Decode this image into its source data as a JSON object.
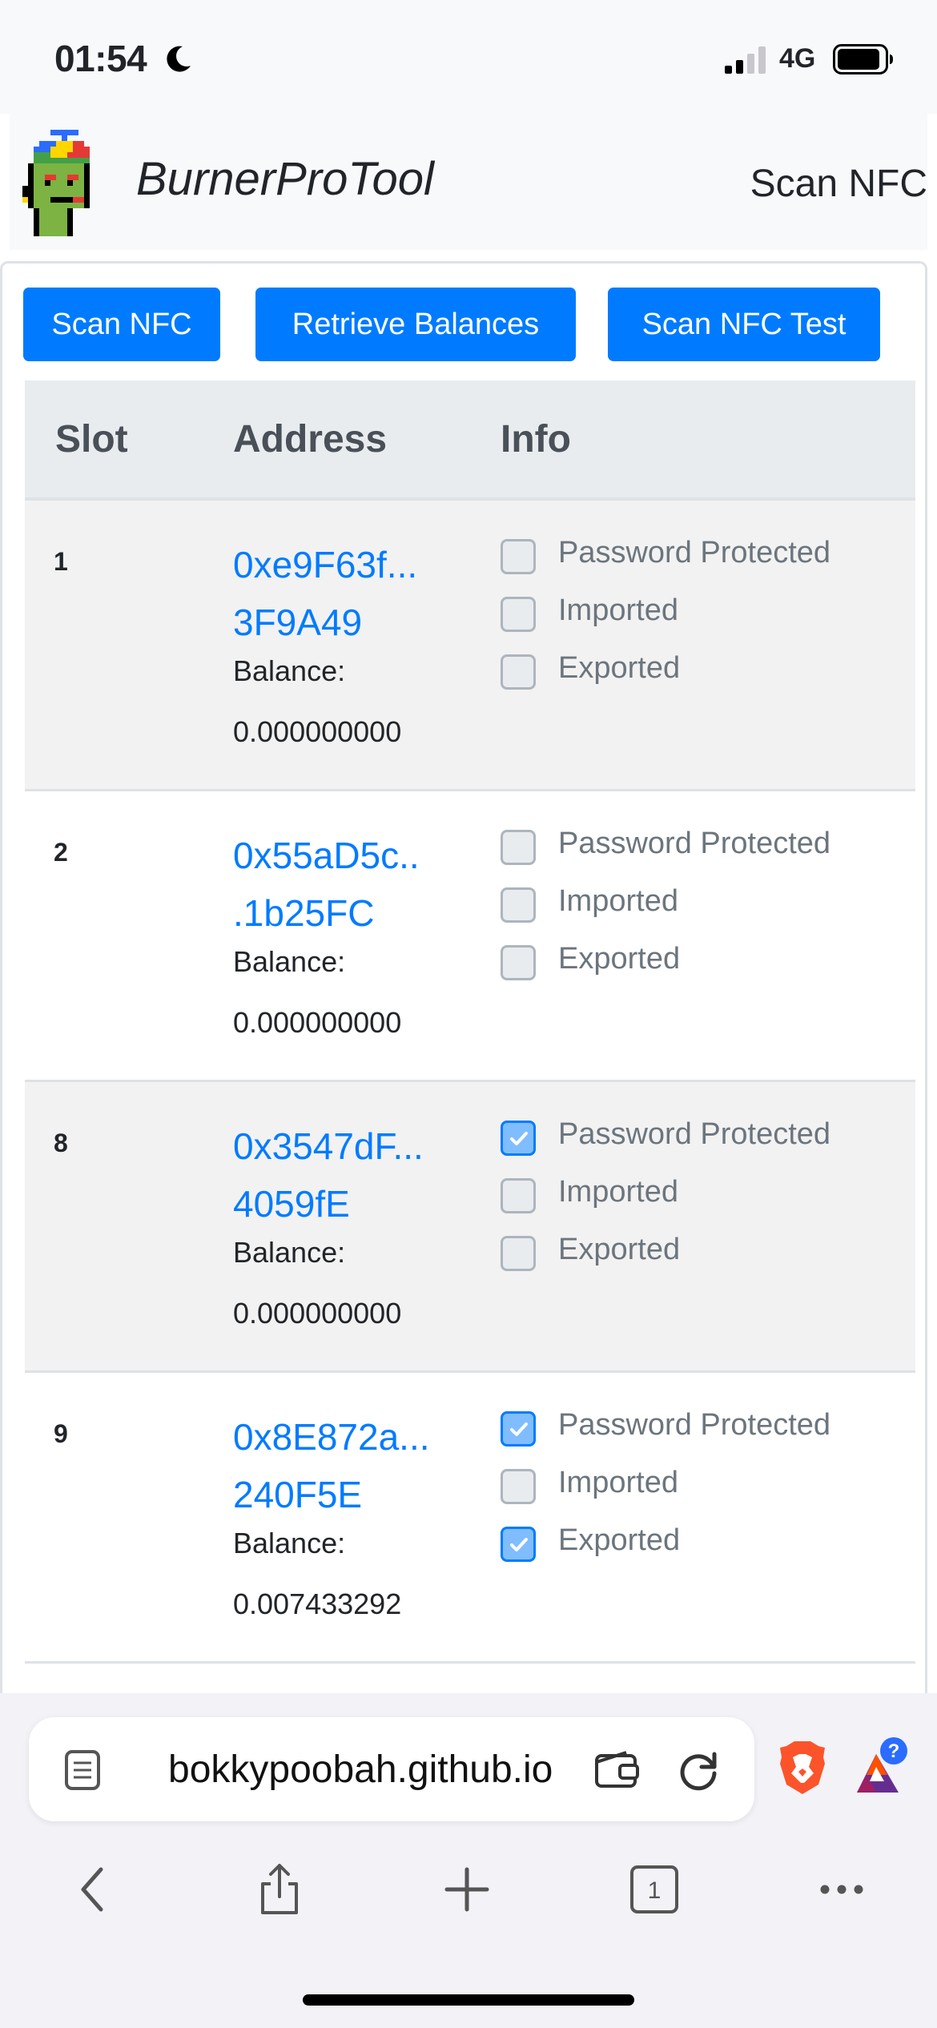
{
  "status_bar": {
    "time": "01:54",
    "network": "4G",
    "icons": [
      "moon-icon",
      "signal-icon",
      "battery-icon"
    ]
  },
  "navbar": {
    "brand": "BurnerProTool",
    "link": "Scan NFC",
    "logo": "pixel-punk-logo"
  },
  "toolbar": {
    "scan_nfc": "Scan NFC",
    "retrieve_balances": "Retrieve Balances",
    "scan_nfc_test": "Scan NFC Test"
  },
  "table": {
    "headers": {
      "slot": "Slot",
      "address": "Address",
      "info": "Info"
    },
    "rows": [
      {
        "slot": "1",
        "address_line1": "0xe9F63f...",
        "address_line2": "3F9A49",
        "balance_label": "Balance:",
        "balance": "0.000000000",
        "info": [
          {
            "label": "Password Protected",
            "checked": false
          },
          {
            "label": "Imported",
            "checked": false
          },
          {
            "label": "Exported",
            "checked": false
          }
        ]
      },
      {
        "slot": "2",
        "address_line1": "0x55aD5c..",
        "address_line2": ".1b25FC",
        "balance_label": "Balance:",
        "balance": "0.000000000",
        "info": [
          {
            "label": "Password Protected",
            "checked": false
          },
          {
            "label": "Imported",
            "checked": false
          },
          {
            "label": "Exported",
            "checked": false
          }
        ]
      },
      {
        "slot": "8",
        "address_line1": "0x3547dF...",
        "address_line2": "4059fE",
        "balance_label": "Balance:",
        "balance": "0.000000000",
        "info": [
          {
            "label": "Password Protected",
            "checked": true
          },
          {
            "label": "Imported",
            "checked": false
          },
          {
            "label": "Exported",
            "checked": false
          }
        ]
      },
      {
        "slot": "9",
        "address_line1": "0x8E872a...",
        "address_line2": "240F5E",
        "balance_label": "Balance:",
        "balance": "0.007433292",
        "info": [
          {
            "label": "Password Protected",
            "checked": true
          },
          {
            "label": "Imported",
            "checked": false
          },
          {
            "label": "Exported",
            "checked": true
          }
        ]
      }
    ]
  },
  "browser": {
    "url": "bokkypoobah.github.io",
    "tab_count": "1",
    "rewards_badge": "?",
    "toolbar_icons": [
      "back-icon",
      "share-icon",
      "new-tab-icon",
      "tabs-icon",
      "more-icon"
    ]
  },
  "colors": {
    "primary": "#007bff",
    "stripe": "#f2f2f2",
    "header_bg": "#e9ecef"
  }
}
